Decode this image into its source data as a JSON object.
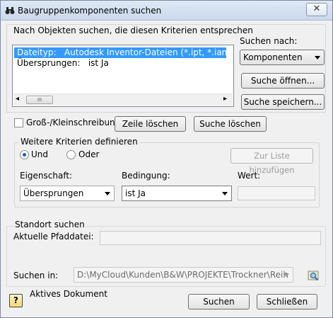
{
  "window": {
    "title": "Baugruppenkomponenten suchen",
    "close_glyph": "✕"
  },
  "criteria": {
    "heading": "Nach Objekten suchen, die diesen Kriterien entsprechen",
    "rows": [
      {
        "text": "Dateityp:   Autodesk Inventor-Dateien (*.ipt, *.iam)",
        "selected": true
      },
      {
        "text": "Übersprungen:   ist Ja",
        "selected": false
      }
    ],
    "scroll_left": "◂",
    "scroll_right": "▸",
    "scroll_grip": "III"
  },
  "search_for": {
    "label": "Suchen nach:",
    "value": "Komponenten",
    "open_button": "Suche öffnen...",
    "save_button": "Suche speichern..."
  },
  "options": {
    "case_label": "Groß-/Kleinschreibung",
    "delete_row_button": "Zeile löschen",
    "delete_search_button": "Suche löschen"
  },
  "more_criteria": {
    "legend": "Weitere Kriterien definieren",
    "and_label": "Und",
    "or_label": "Oder",
    "add_to_list_button": "Zur Liste hinzufügen",
    "property_label": "Eigenschaft:",
    "property_value": "Übersprungen",
    "condition_label": "Bedingung:",
    "condition_value": "ist Ja",
    "value_label": "Wert:",
    "value_value": ""
  },
  "location": {
    "legend": "Standort suchen",
    "current_file_label": "Aktuelle Pfaddatei:",
    "current_file_value": "",
    "search_in_label": "Suchen in:",
    "search_in_value": "D:\\MyCloud\\Kunden\\B&W\\PROJEKTE\\Trockner\\Reih"
  },
  "footer": {
    "help_glyph": "?",
    "active_doc_label": "Aktives Dokument",
    "search_button": "Suchen",
    "close_button": "Schließen"
  }
}
